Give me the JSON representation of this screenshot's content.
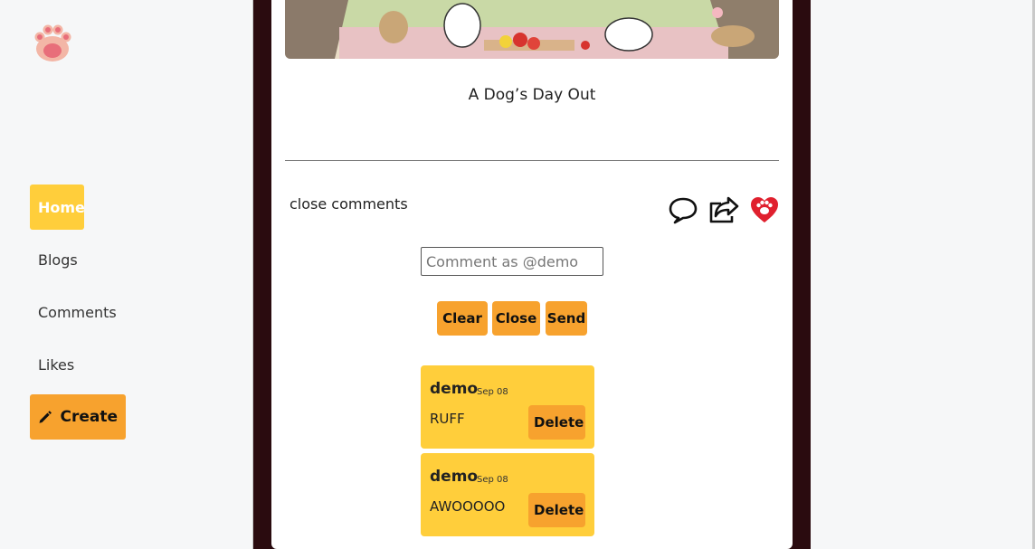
{
  "sidebar": {
    "logo_icon": "paw-icon",
    "items": [
      {
        "label": "Home"
      },
      {
        "label": "Blogs"
      },
      {
        "label": "Comments"
      },
      {
        "label": "Likes"
      },
      {
        "label": "Create",
        "icon": "pencil-icon"
      }
    ]
  },
  "post": {
    "title": "A Dog’s Day Out"
  },
  "comments_section": {
    "toggle_label": "close comments",
    "input_placeholder": "Comment as @demo",
    "clear_label": "Clear",
    "close_label": "Close",
    "send_label": "Send",
    "items": [
      {
        "author": "demo",
        "date": "Sep 08",
        "text": "RUFF",
        "delete_label": "Delete"
      },
      {
        "author": "demo",
        "date": "Sep 08",
        "text": "AWOOOOO",
        "delete_label": "Delete"
      }
    ]
  },
  "colors": {
    "accent_yellow": "#ffce3b",
    "accent_orange": "#f7a22e",
    "dark_column": "#2a0b0f",
    "like_red": "#e0202e"
  }
}
